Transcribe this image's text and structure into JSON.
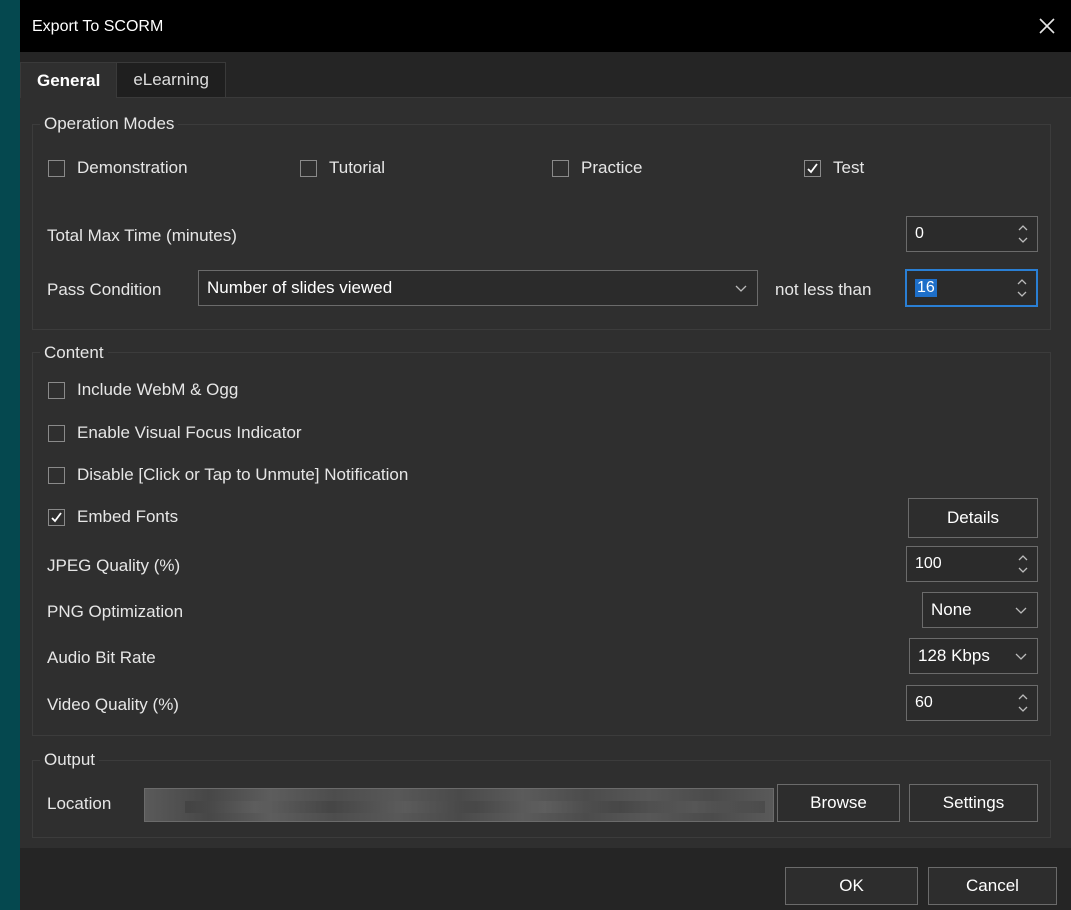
{
  "window": {
    "title": "Export To SCORM"
  },
  "tabs": [
    {
      "label": "General",
      "active": true
    },
    {
      "label": "eLearning",
      "active": false
    }
  ],
  "operation_modes": {
    "title": "Operation Modes",
    "modes": [
      {
        "label": "Demonstration",
        "checked": false
      },
      {
        "label": "Tutorial",
        "checked": false
      },
      {
        "label": "Practice",
        "checked": false
      },
      {
        "label": "Test",
        "checked": true
      }
    ],
    "total_max_time_label": "Total Max Time (minutes)",
    "total_max_time_value": "0",
    "pass_condition_label": "Pass Condition",
    "pass_condition_value": "Number of slides viewed",
    "not_less_than_label": "not less than",
    "not_less_than_value": "16"
  },
  "content": {
    "title": "Content",
    "options": [
      {
        "label": "Include WebM & Ogg",
        "checked": false
      },
      {
        "label": "Enable Visual Focus Indicator",
        "checked": false
      },
      {
        "label": "Disable [Click or Tap to Unmute] Notification",
        "checked": false
      },
      {
        "label": "Embed Fonts",
        "checked": true
      }
    ],
    "details_label": "Details",
    "jpeg_quality_label": "JPEG Quality (%)",
    "jpeg_quality_value": "100",
    "png_optimization_label": "PNG Optimization",
    "png_optimization_value": "None",
    "audio_bit_rate_label": "Audio Bit Rate",
    "audio_bit_rate_value": "128 Kbps",
    "video_quality_label": "Video Quality (%)",
    "video_quality_value": "60"
  },
  "output": {
    "title": "Output",
    "location_label": "Location",
    "browse_label": "Browse",
    "settings_label": "Settings"
  },
  "footer": {
    "ok_label": "OK",
    "cancel_label": "Cancel"
  },
  "colors": {
    "desktop": "#05484f",
    "titlebar": "#000000",
    "panel": "#2f2f2f",
    "accent": "#2a7fd4"
  }
}
